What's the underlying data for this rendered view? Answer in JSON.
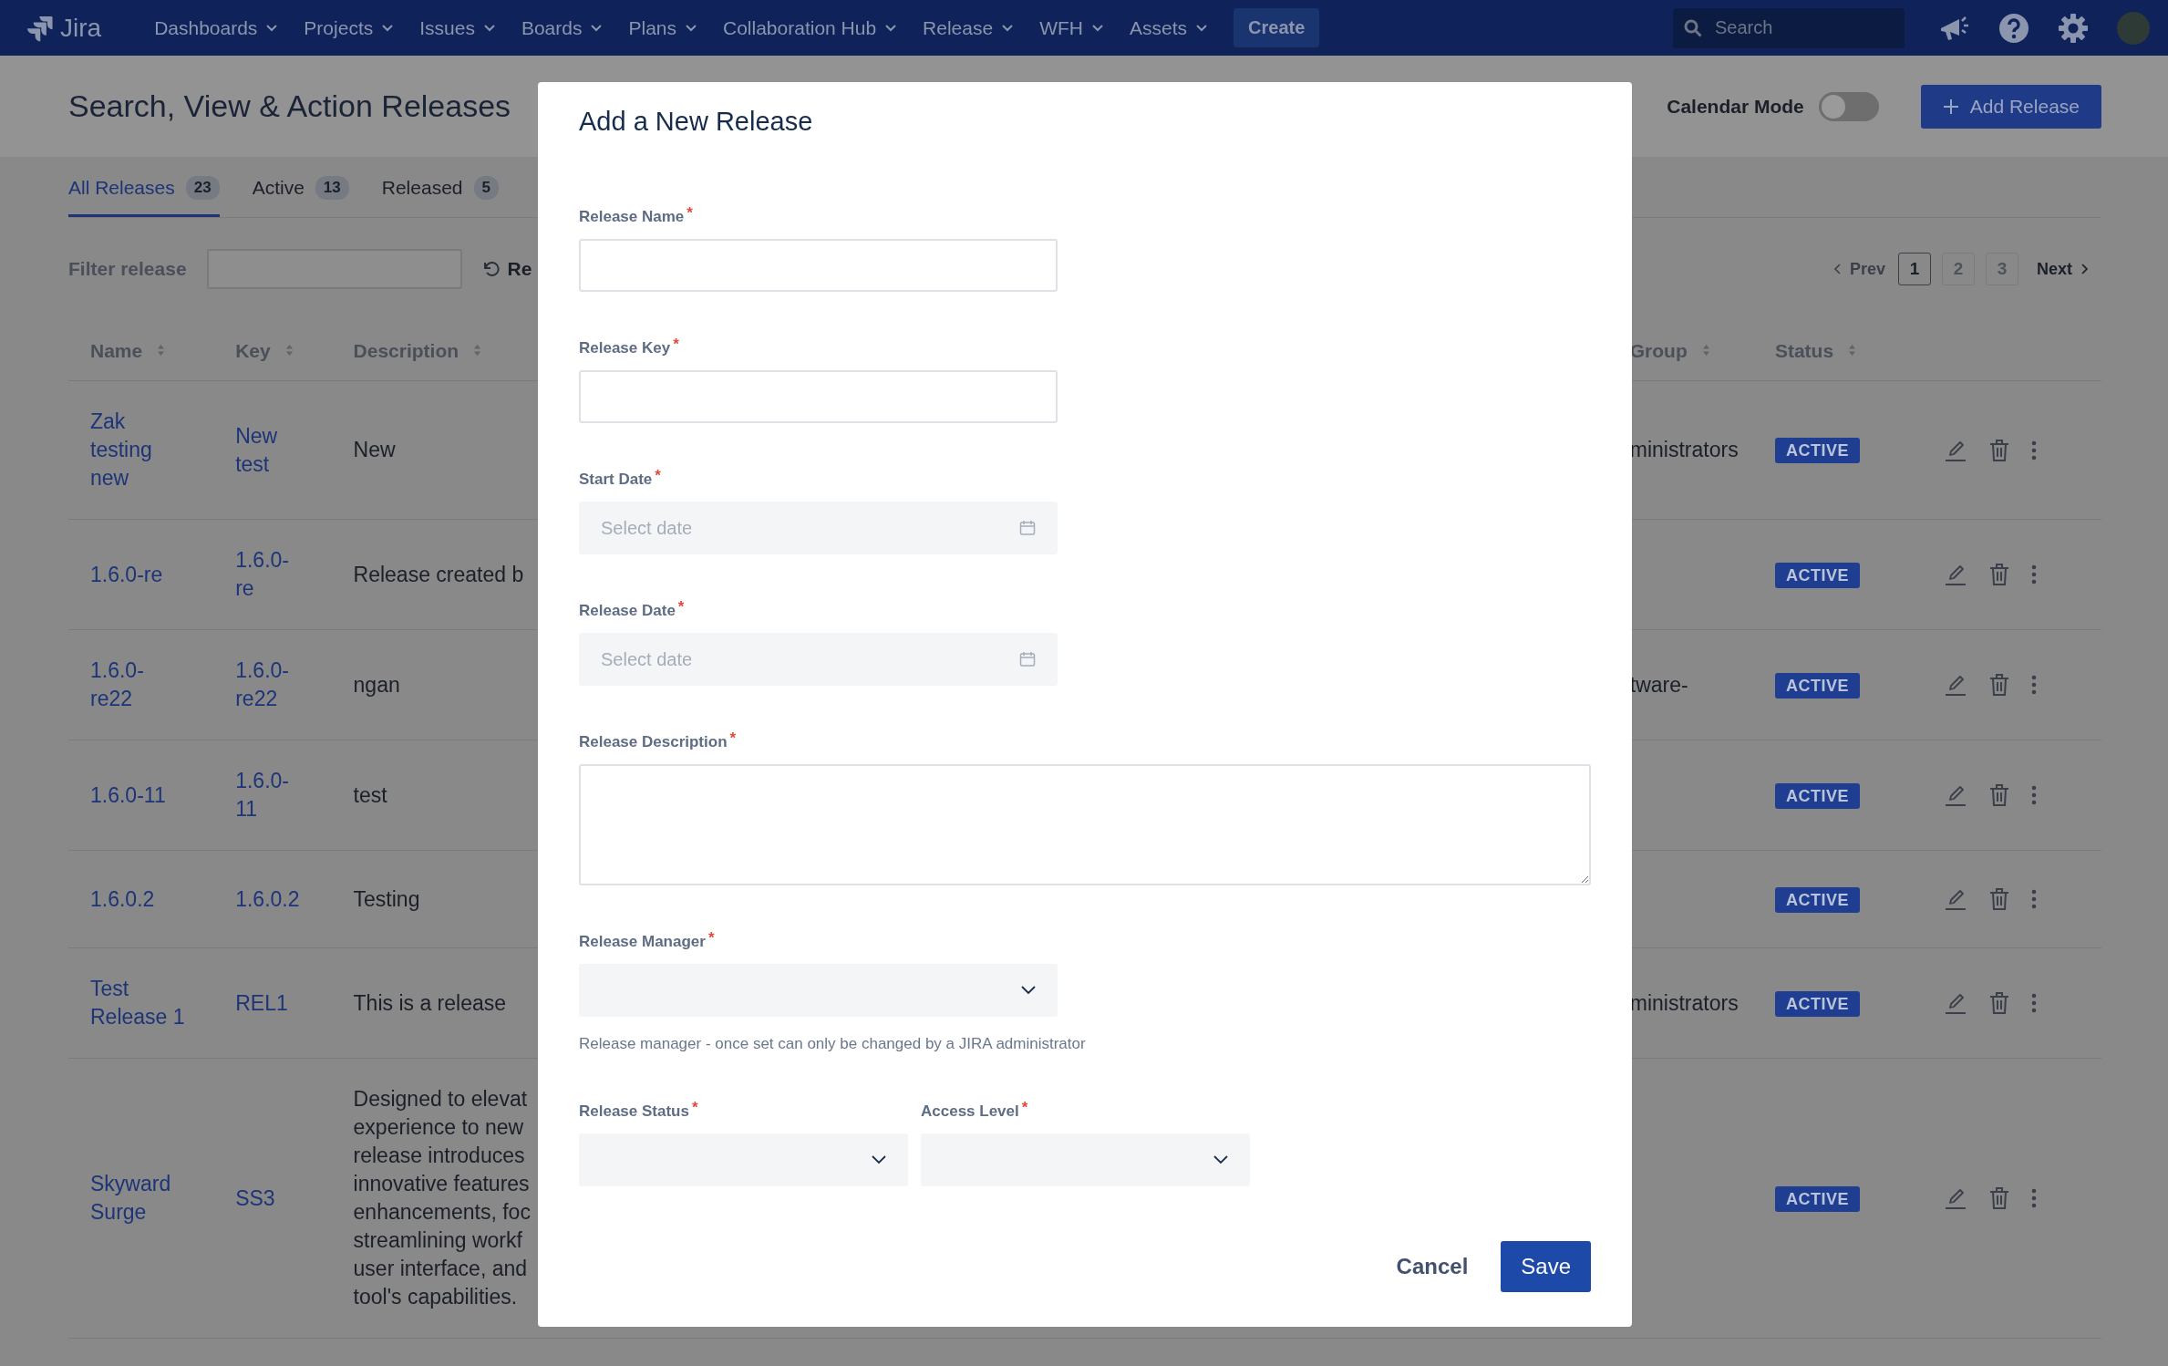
{
  "nav": {
    "logo": "Jira",
    "menus": [
      {
        "label": "Dashboards"
      },
      {
        "label": "Projects"
      },
      {
        "label": "Issues"
      },
      {
        "label": "Boards"
      },
      {
        "label": "Plans"
      },
      {
        "label": "Collaboration Hub"
      },
      {
        "label": "Release"
      },
      {
        "label": "WFH"
      },
      {
        "label": "Assets"
      }
    ],
    "create": "Create",
    "search_placeholder": "Search"
  },
  "page": {
    "title": "Search, View & Action Releases",
    "calendar_mode": {
      "label": "Calendar Mode",
      "on": false
    },
    "add_button": "Add Release"
  },
  "tabs": [
    {
      "label": "All Releases",
      "count": "23",
      "selected": true
    },
    {
      "label": "Active",
      "count": "13",
      "selected": false
    },
    {
      "label": "Released",
      "count": "5",
      "selected": false
    }
  ],
  "filter": {
    "label": "Filter release",
    "reset": "Re"
  },
  "pagination": {
    "prev": "Prev",
    "next": "Next",
    "pages": [
      {
        "label": "1",
        "selected": true
      },
      {
        "label": "2",
        "selected": false
      },
      {
        "label": "3",
        "selected": false
      }
    ]
  },
  "table": {
    "columns": [
      {
        "label": "Name",
        "sortable": true
      },
      {
        "label": "Key",
        "sortable": true
      },
      {
        "label": "Description",
        "sortable": true
      },
      {
        "label": "Group",
        "sortable": true
      },
      {
        "label": "Status",
        "sortable": true
      }
    ],
    "rows": [
      {
        "name": "Zak testing new",
        "key": "New test",
        "description": [
          "New"
        ],
        "group": "ministrators",
        "status": "ACTIVE"
      },
      {
        "name": "1.6.0-re",
        "key": "1.6.0-re",
        "description": [
          "Release created b"
        ],
        "status": "ACTIVE"
      },
      {
        "name": "1.6.0-re22",
        "key": "1.6.0-re22",
        "description": [
          "ngan"
        ],
        "group": "tware-",
        "status": "ACTIVE"
      },
      {
        "name": "1.6.0-11",
        "key": "1.6.0-11",
        "description": [
          "test"
        ],
        "status": "ACTIVE"
      },
      {
        "name": "1.6.0.2",
        "key": "1.6.0.2",
        "description": [
          "Testing"
        ],
        "status": "ACTIVE"
      },
      {
        "name": "Test Release 1",
        "key": "REL1",
        "description": [
          "This is a release"
        ],
        "group": "ministrators",
        "status": "ACTIVE"
      },
      {
        "name": "Skyward Surge",
        "key": "SS3",
        "description": [
          "Designed to elevat",
          "experience to new",
          "release introduces",
          "innovative features",
          "enhancements, foc",
          "streamlining workf",
          "user interface, and",
          "tool's capabilities."
        ],
        "status": "ACTIVE"
      }
    ]
  },
  "modal": {
    "title": "Add a New Release",
    "required_mark": "*",
    "rows": [
      [
        {
          "kind": "text",
          "label": "Release Name",
          "required": true
        }
      ],
      [
        {
          "kind": "text",
          "label": "Release Key",
          "required": true
        }
      ],
      [
        {
          "kind": "date",
          "label": "Start Date",
          "required": true,
          "placeholder": "Select date"
        }
      ],
      [
        {
          "kind": "date",
          "label": "Release Date",
          "required": true,
          "placeholder": "Select date"
        }
      ],
      [
        {
          "kind": "textarea",
          "label": "Release Description",
          "required": true
        }
      ],
      [
        {
          "kind": "select",
          "label": "Release Manager",
          "required": true,
          "help": "Release manager - once set can only be changed by a JIRA administrator"
        }
      ],
      [
        {
          "kind": "select",
          "label": "Release Status",
          "required": true
        },
        {
          "kind": "select",
          "label": "Access Level",
          "required": true
        }
      ]
    ],
    "cancel": "Cancel",
    "save": "Save"
  }
}
